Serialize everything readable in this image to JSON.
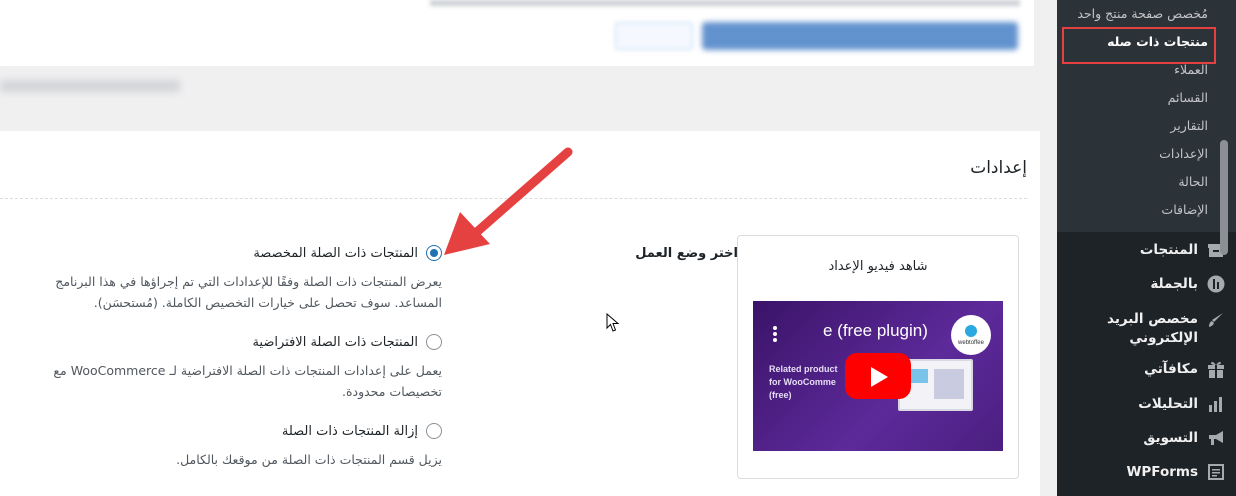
{
  "settings": {
    "title": "إعدادات",
    "mode_label": "اختر وضع العمل",
    "options": [
      {
        "label": "المنتجات ذات الصلة المخصصة",
        "description": "يعرض المنتجات ذات الصلة وفقًا للإعدادات التي تم إجراؤها في هذا البرنامج المساعد. سوف تحصل على خيارات التخصيص الكاملة. (مُستحسَن).",
        "checked": true
      },
      {
        "label": "المنتجات ذات الصلة الافتراضية",
        "description": "يعمل على إعدادات المنتجات ذات الصلة الافتراضية لـ WooCommerce مع تخصيصات محدودة.",
        "checked": false
      },
      {
        "label": "إزالة المنتجات ذات الصلة",
        "description": "يزيل قسم المنتجات ذات الصلة من موقعك بالكامل.",
        "checked": false
      }
    ]
  },
  "video": {
    "title": "شاهد فيديو الإعداد",
    "thumb_heading": "e (free plugin)",
    "thumb_lines": [
      "Related product",
      "for WooComme",
      "(free)"
    ],
    "logo_text": "webtoffee"
  },
  "sidebar": {
    "submenu": [
      {
        "label": "مُخصص صفحة منتج واحد",
        "current": false
      },
      {
        "label": "منتجات ذات صله",
        "current": true
      },
      {
        "label": "العملاء",
        "current": false
      },
      {
        "label": "القسائم",
        "current": false
      },
      {
        "label": "التقارير",
        "current": false
      },
      {
        "label": "الإعدادات",
        "current": false
      },
      {
        "label": "الحالة",
        "current": false
      },
      {
        "label": "الإضافات",
        "current": false
      }
    ],
    "menu": [
      {
        "label": "المنتجات",
        "icon": "archive-icon"
      },
      {
        "label": "بالجملة",
        "icon": "wholesale-icon"
      },
      {
        "label": "مخصص البريد الإلكتروني",
        "icon": "brush-icon"
      },
      {
        "label": "مكافآتي",
        "icon": "gift-icon"
      },
      {
        "label": "التحليلات",
        "icon": "bar-chart-icon"
      },
      {
        "label": "التسويق",
        "icon": "megaphone-icon"
      },
      {
        "label": "WPForms",
        "icon": "form-icon"
      }
    ]
  },
  "colors": {
    "accent": "#2271b1",
    "annotation": "#e64141",
    "sidebar_bg": "#1d2327",
    "submenu_bg": "#2c3338"
  }
}
